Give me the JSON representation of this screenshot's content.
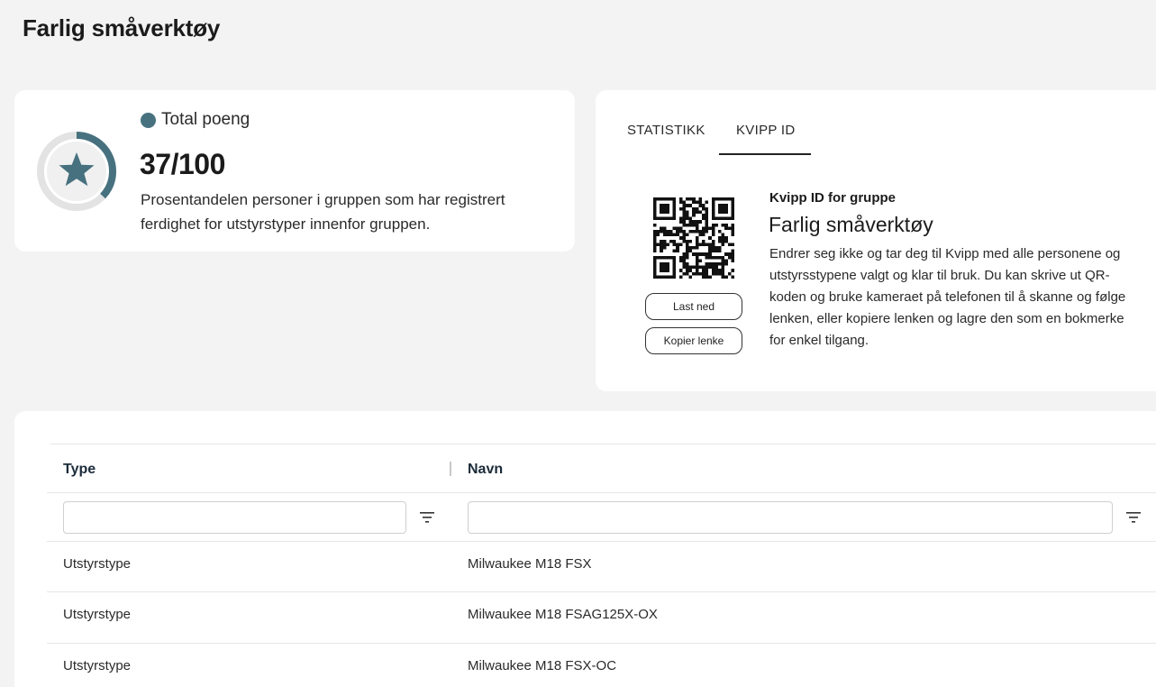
{
  "page": {
    "title": "Farlig småverktøy"
  },
  "score": {
    "label": "Total poeng",
    "value_text": "37/100",
    "fraction": 0.37,
    "description": "Prosentandelen personer i gruppen som har registrert ferdighet for utstyrstyper innenfor gruppen.",
    "icon": "star-icon",
    "accent_color": "#47717f"
  },
  "kvipp": {
    "tabs": [
      {
        "label": "STATISTIKK",
        "active": false
      },
      {
        "label": "KVIPP ID",
        "active": true
      }
    ],
    "subtitle": "Kvipp ID for gruppe",
    "name": "Farlig småverktøy",
    "description": "Endrer seg ikke og tar deg til Kvipp med alle personene og utstyrsstypene valgt og klar til bruk. Du kan skrive ut QR-koden og bruke kameraet på telefonen til å skanne og følge lenken, eller kopiere lenken og lagre den som en bokmerke for enkel tilgang.",
    "download_label": "Last ned",
    "copy_label": "Kopier lenke",
    "qr_icon": "qr-code-icon"
  },
  "table": {
    "columns": [
      {
        "label": "Type",
        "filter_value": ""
      },
      {
        "label": "Navn",
        "filter_value": ""
      }
    ],
    "filter_icon": "filter-icon",
    "rows": [
      {
        "type": "Utstyrstype",
        "name": "Milwaukee M18 FSX"
      },
      {
        "type": "Utstyrstype",
        "name": "Milwaukee M18 FSAG125X-OX"
      },
      {
        "type": "Utstyrstype",
        "name": "Milwaukee M18 FSX-OC"
      }
    ]
  }
}
